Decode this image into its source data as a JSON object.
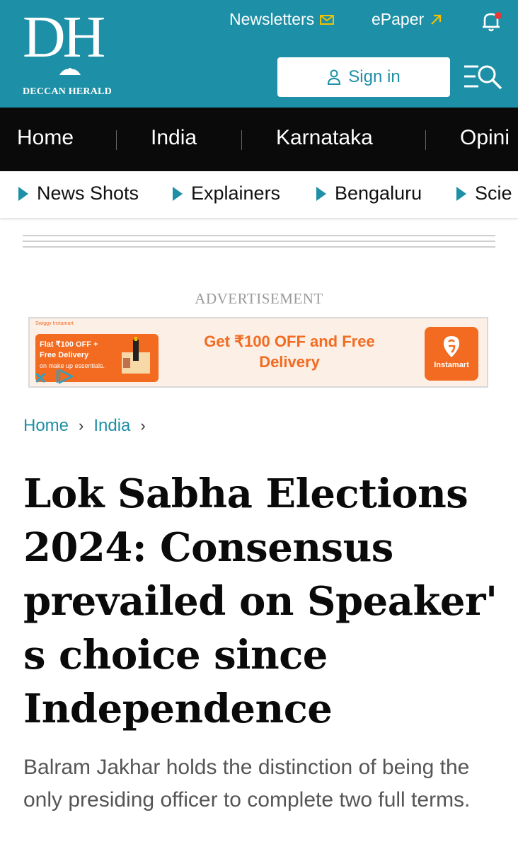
{
  "header": {
    "logo_text": "DH",
    "logo_subtitle": "DECCAN HERALD",
    "newsletters_label": "Newsletters",
    "newsletters_icon": "envelope-icon",
    "epaper_label": "ePaper",
    "epaper_icon": "arrow-up-right-icon",
    "signin_label": "Sign in",
    "bg_color": "#1d8fa6",
    "accent_color": "#f2c200"
  },
  "main_nav": {
    "items": [
      "Home",
      "India",
      "Karnataka",
      "Opini"
    ]
  },
  "sub_nav": {
    "items": [
      "News Shots",
      "Explainers",
      "Bengaluru",
      "Scie"
    ]
  },
  "advertisement": {
    "label": "ADVERTISEMENT",
    "brand_small": "Swiggy Instamart",
    "left_line1": "Flat ₹100 OFF +",
    "left_line2": "Free Delivery",
    "left_line3": "on make up essentials.",
    "headline": "Get ₹100 OFF and Free Delivery",
    "logo_label": "Instamart",
    "brand_color": "#f26b21"
  },
  "breadcrumb": {
    "items": [
      "Home",
      "India"
    ]
  },
  "article": {
    "title": "Lok Sabha Elections 2024: Consensus prevailed on Speaker' s choice since Independence",
    "summary": "Balram Jakhar holds the distinction of being the only presiding officer to complete two full terms."
  }
}
